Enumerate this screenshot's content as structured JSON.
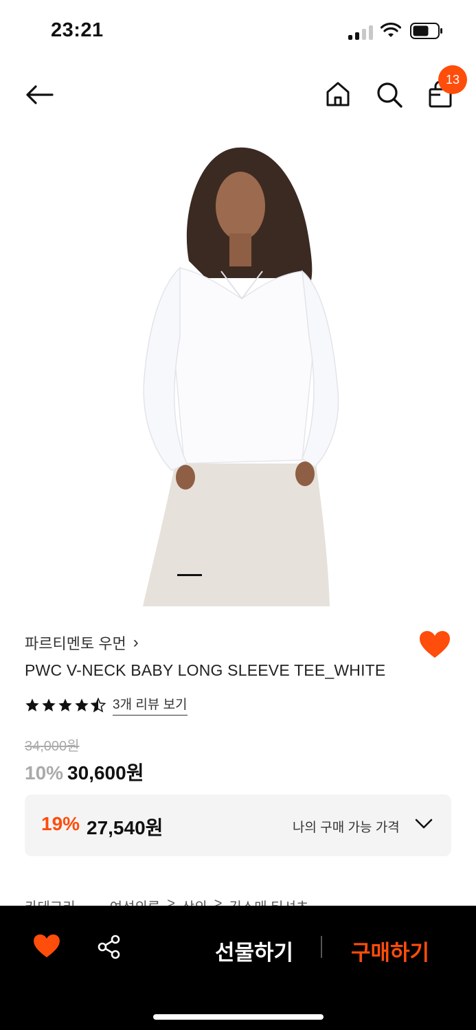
{
  "status_bar": {
    "time": "23:21"
  },
  "header": {
    "back_icon": "arrow-left-icon",
    "home_icon": "home-icon",
    "search_icon": "search-icon",
    "cart_icon": "shopping-bag-icon",
    "cart_count": "13"
  },
  "product": {
    "brand": "파르티멘토 우먼",
    "brand_chevron": "›",
    "name": "PWC V-NECK BABY LONG SLEEVE TEE_WHITE",
    "rating": 4.5,
    "review_link": "3개 리뷰 보기",
    "original_price": "34,000원",
    "discount_rate": "10%",
    "sale_price": "30,600원",
    "my_price": {
      "rate": "19%",
      "price": "27,540원",
      "label": "나의 구매 가능 가격"
    },
    "category": {
      "label": "카테고리",
      "path": [
        "여성의류",
        ">",
        "상의",
        ">",
        "긴소매 티셔츠"
      ]
    }
  },
  "bottom_bar": {
    "wish_icon": "heart-icon",
    "share_icon": "share-icon",
    "gift_label": "선물하기",
    "buy_label": "구매하기"
  },
  "colors": {
    "accent": "#ff4d0b",
    "bar_bg": "#000000",
    "price_box_bg": "#f4f4f4"
  }
}
